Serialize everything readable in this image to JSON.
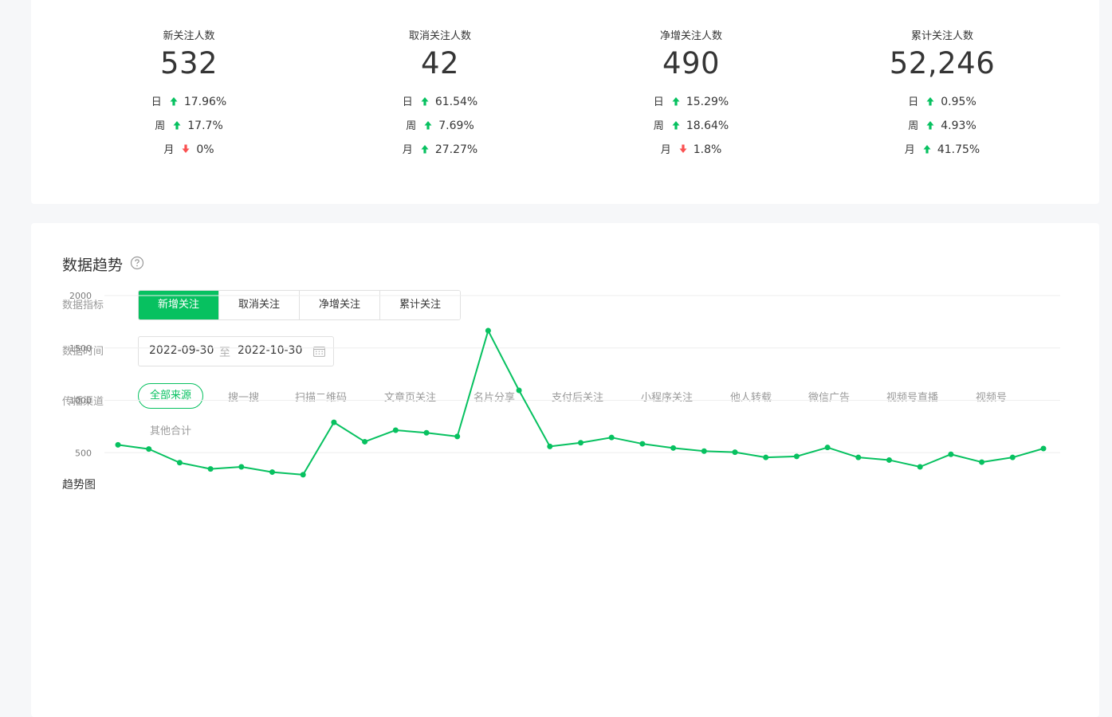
{
  "overview": {
    "stats": [
      {
        "label": "新关注人数",
        "value": "532",
        "changes": [
          {
            "period": "日",
            "dir": "up",
            "pct": "17.96%"
          },
          {
            "period": "周",
            "dir": "up",
            "pct": "17.7%"
          },
          {
            "period": "月",
            "dir": "down",
            "pct": "0%"
          }
        ]
      },
      {
        "label": "取消关注人数",
        "value": "42",
        "changes": [
          {
            "period": "日",
            "dir": "up",
            "pct": "61.54%"
          },
          {
            "period": "周",
            "dir": "up",
            "pct": "7.69%"
          },
          {
            "period": "月",
            "dir": "up",
            "pct": "27.27%"
          }
        ]
      },
      {
        "label": "净增关注人数",
        "value": "490",
        "changes": [
          {
            "period": "日",
            "dir": "up",
            "pct": "15.29%"
          },
          {
            "period": "周",
            "dir": "up",
            "pct": "18.64%"
          },
          {
            "period": "月",
            "dir": "down",
            "pct": "1.8%"
          }
        ]
      },
      {
        "label": "累计关注人数",
        "value": "52,246",
        "changes": [
          {
            "period": "日",
            "dir": "up",
            "pct": "0.95%"
          },
          {
            "period": "周",
            "dir": "up",
            "pct": "4.93%"
          },
          {
            "period": "月",
            "dir": "up",
            "pct": "41.75%"
          }
        ]
      }
    ]
  },
  "trend": {
    "title": "数据趋势",
    "help_icon": "question-circle-icon",
    "metric_label": "数据指标",
    "metrics": [
      "新增关注",
      "取消关注",
      "净增关注",
      "累计关注"
    ],
    "metric_active": 0,
    "time_label": "数据时间",
    "date_start": "2022-09-30",
    "date_sep": "至",
    "date_end": "2022-10-30",
    "calendar_icon": "calendar-icon",
    "channel_label": "传播渠道",
    "channels": [
      "全部来源",
      "搜一搜",
      "扫描二维码",
      "文章页关注",
      "名片分享",
      "支付后关注",
      "小程序关注",
      "他人转载",
      "微信广告",
      "视频号直播",
      "视频号",
      "其他合计"
    ],
    "channel_active": 0,
    "chart_title": "趋势图"
  },
  "colors": {
    "accent": "#07c160",
    "up": "#07c160",
    "down": "#fa5151",
    "grid": "#eeeeee"
  },
  "chart_data": {
    "type": "line",
    "yticks": [
      500,
      1000,
      1500,
      2000
    ],
    "ylim": [
      0,
      2000
    ],
    "series": [
      {
        "values": [
          575,
          535,
          405,
          345,
          365,
          315,
          290,
          790,
          605,
          715,
          690,
          655,
          1665,
          1095,
          560,
          595,
          645,
          585,
          545,
          515,
          505,
          455,
          465,
          550,
          455,
          430,
          365,
          485,
          410,
          455,
          540
        ]
      }
    ]
  }
}
